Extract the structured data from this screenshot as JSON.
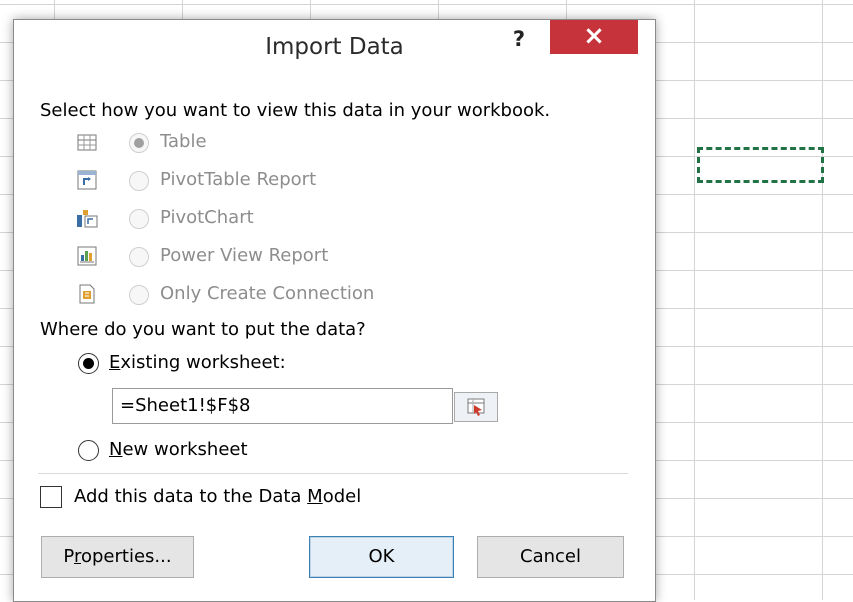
{
  "dialog": {
    "title": "Import Data",
    "help_label": "?",
    "close_label": "×",
    "view_prompt": "Select how you want to view this data in your workbook.",
    "view_options": [
      {
        "label": "Table",
        "icon": "table-icon",
        "selected": true
      },
      {
        "label": "PivotTable Report",
        "icon": "pivottable-icon",
        "selected": false
      },
      {
        "label": "PivotChart",
        "icon": "pivotchart-icon",
        "selected": false
      },
      {
        "label": "Power View Report",
        "icon": "power-view-icon",
        "selected": false
      },
      {
        "label": "Only Create Connection",
        "icon": "connection-icon",
        "selected": false
      }
    ],
    "where_prompt": "Where do you want to put the data?",
    "existing_worksheet": {
      "prefix": "",
      "accel": "E",
      "rest": "xisting worksheet:",
      "selected": true
    },
    "reference_value": "=Sheet1!$F$8",
    "new_worksheet": {
      "accel": "N",
      "rest": "ew worksheet",
      "selected": false
    },
    "data_model": {
      "pre": "Add this data to the Data ",
      "accel": "M",
      "post": "odel",
      "checked": false
    },
    "buttons": {
      "properties": {
        "pre": "P",
        "accel": "r",
        "post": "operties..."
      },
      "ok": "OK",
      "cancel": "Cancel"
    }
  },
  "colors": {
    "close": "#c7333a",
    "selection_marquee": "#217346"
  }
}
